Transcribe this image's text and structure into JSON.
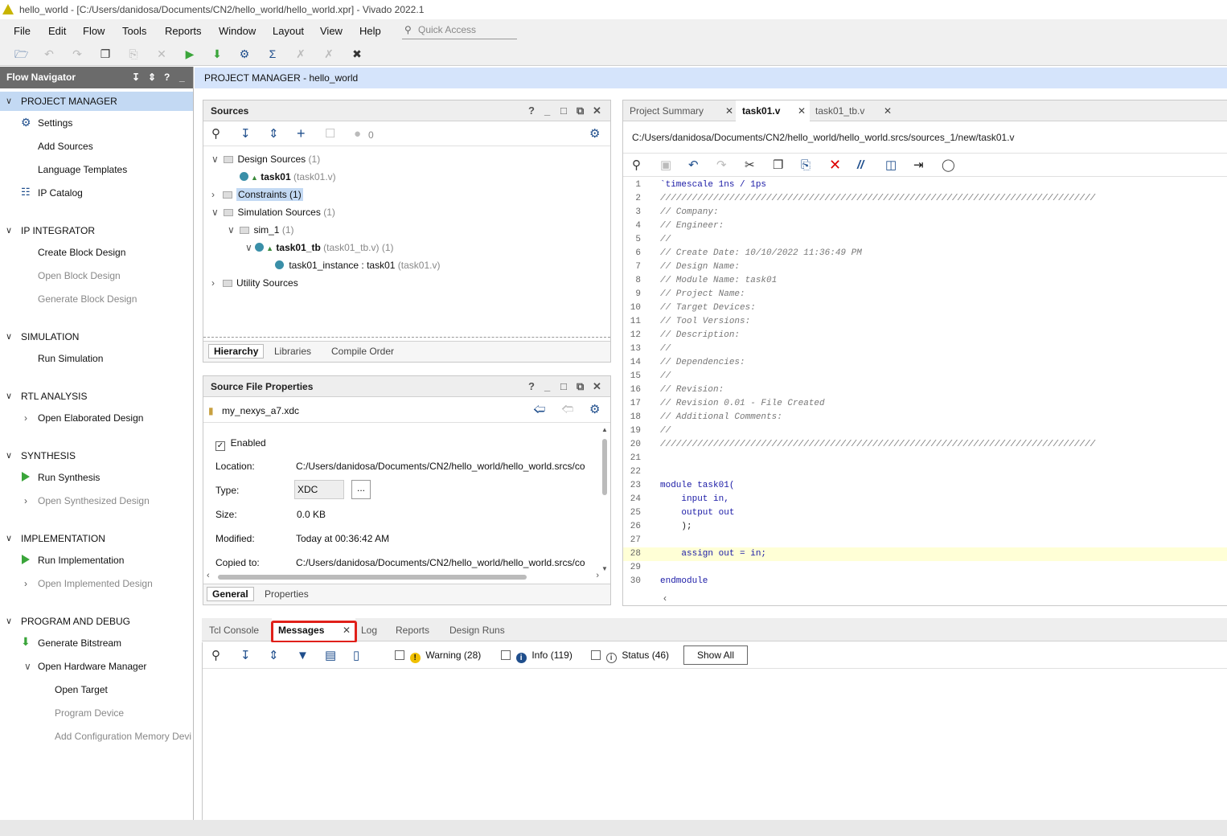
{
  "window": {
    "title": "hello_world - [C:/Users/danidosa/Documents/CN2/hello_world/hello_world.xpr] - Vivado 2022.1"
  },
  "menu": [
    "File",
    "Edit",
    "Flow",
    "Tools",
    "Reports",
    "Window",
    "Layout",
    "View",
    "Help"
  ],
  "quick_access": {
    "placeholder": "Quick Access"
  },
  "toolbar": {
    "icons": [
      "open-project-icon",
      "undo-icon",
      "redo-icon",
      "copy-icon",
      "paste-icon",
      "delete-icon",
      "run-icon",
      "program-icon",
      "settings-icon",
      "sigma-icon",
      "disabled-icon",
      "disabled-icon",
      "wand-icon"
    ]
  },
  "flow_navigator": {
    "title": "Flow Navigator",
    "project_manager": {
      "label": "PROJECT MANAGER",
      "items": [
        "Settings",
        "Add Sources",
        "Language Templates",
        "IP Catalog"
      ]
    },
    "ip_integrator": {
      "label": "IP INTEGRATOR",
      "items": [
        "Create Block Design",
        "Open Block Design",
        "Generate Block Design"
      ]
    },
    "simulation": {
      "label": "SIMULATION",
      "items": [
        "Run Simulation"
      ]
    },
    "rtl_analysis": {
      "label": "RTL ANALYSIS",
      "items": [
        "Open Elaborated Design"
      ]
    },
    "synthesis": {
      "label": "SYNTHESIS",
      "items": [
        "Run Synthesis",
        "Open Synthesized Design"
      ]
    },
    "implementation": {
      "label": "IMPLEMENTATION",
      "items": [
        "Run Implementation",
        "Open Implemented Design"
      ]
    },
    "program_debug": {
      "label": "PROGRAM AND DEBUG",
      "items": [
        "Generate Bitstream",
        "Open Hardware Manager",
        "Open Target",
        "Program Device",
        "Add Configuration Memory Devi"
      ]
    }
  },
  "pm_header": {
    "prefix": "PROJECT MANAGER",
    "sep": " - ",
    "name": "hello_world"
  },
  "sources": {
    "title": "Sources",
    "count": "0",
    "tree": {
      "design_sources": "Design Sources",
      "design_sources_count": "(1)",
      "task01": "task01",
      "task01_file": "(task01.v)",
      "constraints": "Constraints (1)",
      "sim_sources": "Simulation Sources",
      "sim_sources_count": "(1)",
      "sim_1": "sim_1",
      "sim_1_count": "(1)",
      "task01_tb": "task01_tb",
      "task01_tb_file": "(task01_tb.v) (1)",
      "task01_instance": "task01_instance : task01",
      "task01_instance_file": "(task01.v)",
      "utility": "Utility Sources"
    },
    "tabs": [
      "Hierarchy",
      "Libraries",
      "Compile Order"
    ]
  },
  "sfp": {
    "title": "Source File Properties",
    "file": "my_nexys_a7.xdc",
    "enabled_label": "Enabled",
    "location_label": "Location:",
    "location": "C:/Users/danidosa/Documents/CN2/hello_world/hello_world.srcs/co",
    "type_label": "Type:",
    "type": "XDC",
    "type_btn": "...",
    "size_label": "Size:",
    "size": "0.0 KB",
    "modified_label": "Modified:",
    "modified": "Today at 00:36:42 AM",
    "copied_label": "Copied to:",
    "copied": "C:/Users/danidosa/Documents/CN2/hello_world/hello_world.srcs/co",
    "tabs": [
      "General",
      "Properties"
    ]
  },
  "editor": {
    "tabs": [
      "Project Summary",
      "task01.v",
      "task01_tb.v"
    ],
    "path": "C:/Users/danidosa/Documents/CN2/hello_world/hello_world.srcs/sources_1/new/task01.v",
    "lines": [
      "`timescale 1ns / 1ps",
      "//////////////////////////////////////////////////////////////////////////////////",
      "// Company: ",
      "// Engineer: ",
      "// ",
      "// Create Date: 10/10/2022 11:36:49 PM",
      "// Design Name: ",
      "// Module Name: task01",
      "// Project Name: ",
      "// Target Devices: ",
      "// Tool Versions: ",
      "// Description: ",
      "// ",
      "// Dependencies: ",
      "// ",
      "// Revision:",
      "// Revision 0.01 - File Created",
      "// Additional Comments:",
      "// ",
      "//////////////////////////////////////////////////////////////////////////////////",
      "",
      "",
      "module task01(",
      "    input in,",
      "    output out",
      "    );",
      "",
      "    assign out = in;",
      "",
      "endmodule"
    ]
  },
  "messages": {
    "tabs": [
      "Tcl Console",
      "Messages",
      "Log",
      "Reports",
      "Design Runs"
    ],
    "warning": "Warning (28)",
    "info": "Info (119)",
    "status": "Status (46)",
    "show_all": "Show All"
  }
}
